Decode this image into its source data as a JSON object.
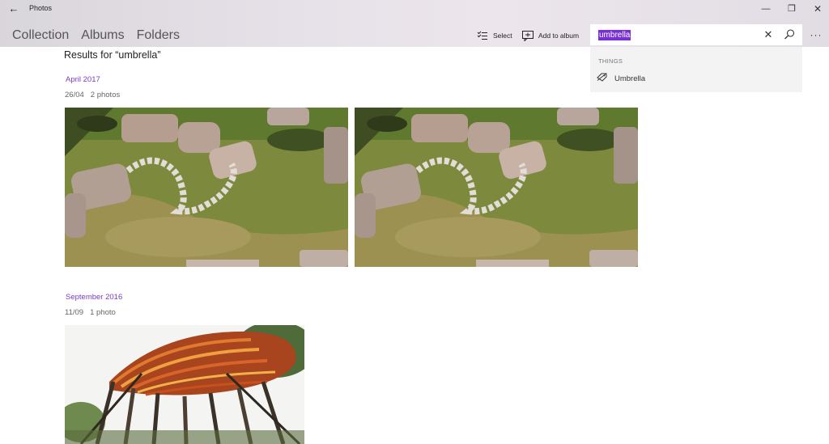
{
  "app": {
    "title": "Photos"
  },
  "window": {
    "back": "←",
    "minimize": "—",
    "maximize": "❐",
    "close": "✕"
  },
  "nav": [
    {
      "label": "Collection"
    },
    {
      "label": "Albums"
    },
    {
      "label": "Folders"
    }
  ],
  "toolbar": {
    "select_label": "Select",
    "add_to_album_label": "Add to album",
    "more": "···"
  },
  "search": {
    "query": "umbrella",
    "clear": "✕"
  },
  "suggestions": {
    "header": "THINGS",
    "items": [
      {
        "label": "Umbrella",
        "icon": "umbrella-tag-icon"
      }
    ]
  },
  "results": {
    "title": "Results for “umbrella”",
    "groups": [
      {
        "month": "April 2017",
        "day": "26/04",
        "count": "2 photos",
        "photos": [
          {
            "subject": "rock-garden"
          },
          {
            "subject": "rock-garden"
          }
        ]
      },
      {
        "month": "September 2016",
        "day": "11/09",
        "count": "1 photo",
        "photos": [
          {
            "subject": "wooden-sculpture"
          }
        ]
      }
    ]
  },
  "colors": {
    "accent": "#7a2fd6",
    "date_text": "#7a3cc7",
    "suggest_bg": "#f3f3f3"
  }
}
